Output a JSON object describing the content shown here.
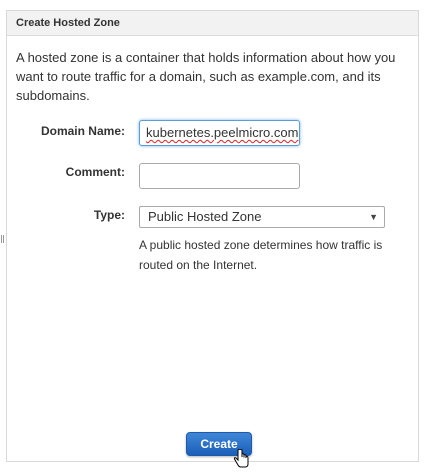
{
  "dialog": {
    "title": "Create Hosted Zone",
    "intro": "A hosted zone is a container that holds information about how you want to route traffic for a domain, such as example.com, and its subdomains."
  },
  "form": {
    "domain_name_label": "Domain Name:",
    "domain_name_value": "kubernetes.peelmicro.com",
    "comment_label": "Comment:",
    "comment_value": "",
    "type_label": "Type:",
    "type_selected": "Public Hosted Zone",
    "type_hint": "A public hosted zone determines how traffic is routed on the Internet."
  },
  "actions": {
    "create_label": "Create"
  },
  "icons": {
    "dropdown": "chevron-down-icon",
    "cursor": "hand-pointer-icon"
  },
  "colors": {
    "button_primary": "#1b5fb8",
    "focus_border": "#5b9dd9"
  }
}
